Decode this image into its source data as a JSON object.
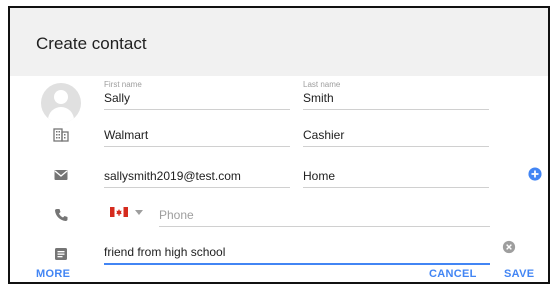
{
  "dialog": {
    "title": "Create contact"
  },
  "fields": {
    "first_name": {
      "label": "First name",
      "value": "Sally"
    },
    "last_name": {
      "label": "Last name",
      "value": "Smith"
    },
    "company": {
      "value": "Walmart"
    },
    "job_title": {
      "value": "Cashier"
    },
    "email": {
      "value": "sallysmith2019@test.com"
    },
    "email_type": {
      "value": "Home"
    },
    "phone": {
      "placeholder": "Phone",
      "country": "Canada"
    },
    "notes": {
      "value": "friend from high school"
    }
  },
  "buttons": {
    "more": "MORE",
    "cancel": "CANCEL",
    "save": "SAVE"
  },
  "colors": {
    "accent": "#4285f4",
    "header_bg": "#f1f1f1",
    "icon_gray": "#757575"
  },
  "icons": {
    "avatar": "person-avatar",
    "company": "building-icon",
    "email": "email-icon",
    "phone": "phone-icon",
    "notes": "notes-icon",
    "add": "add-circle-icon",
    "clear": "clear-circle-icon"
  }
}
